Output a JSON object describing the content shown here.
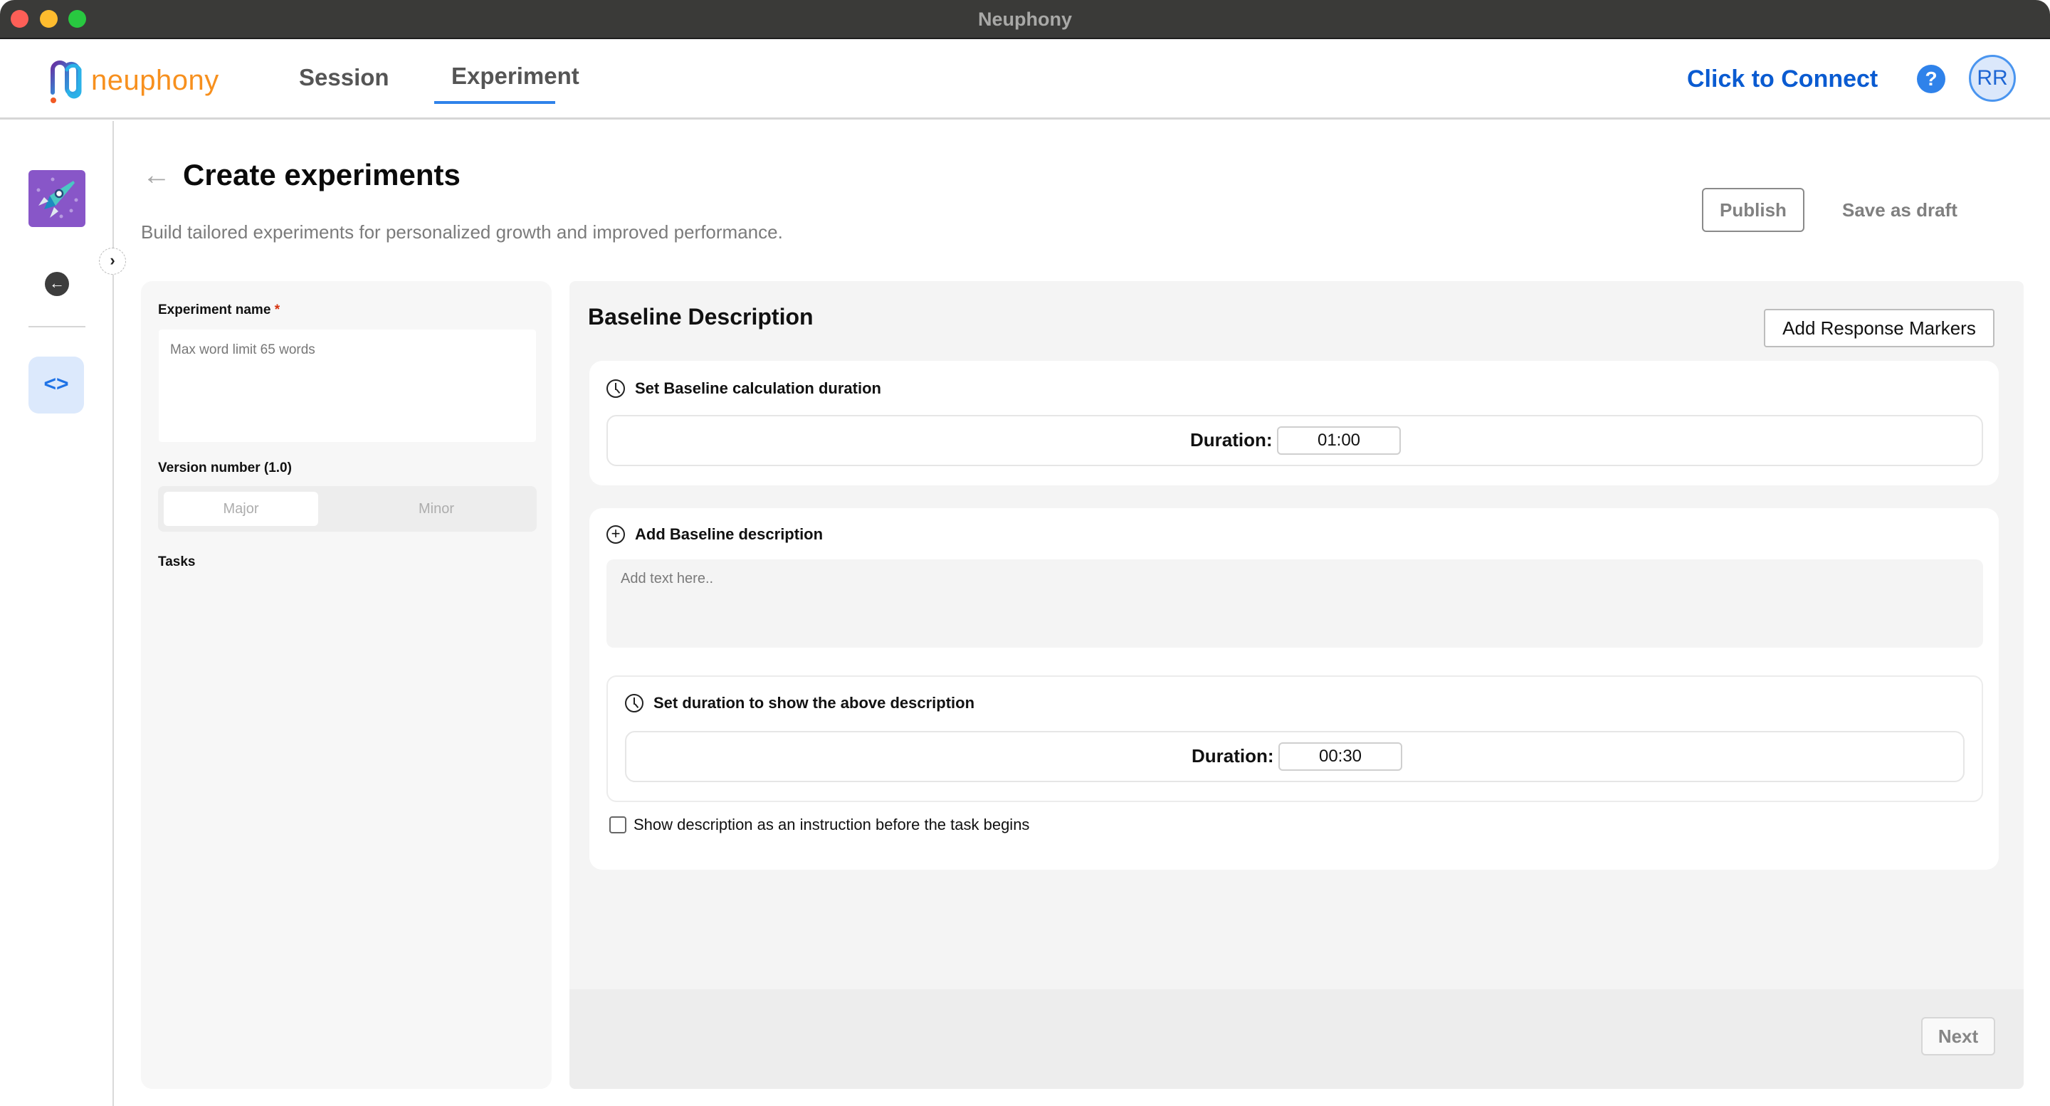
{
  "window": {
    "title": "Neuphony"
  },
  "header": {
    "logo_text": "neuphony",
    "tabs": [
      {
        "label": "Session",
        "active": false
      },
      {
        "label": "Experiment",
        "active": true
      }
    ],
    "connect_label": "Click to Connect",
    "help_icon": "help-circle-icon",
    "avatar_initials": "RR"
  },
  "sidebar": {
    "items": [
      {
        "icon": "rocket-icon",
        "label": ""
      },
      {
        "icon": "arrow-left-circle-icon",
        "label": ""
      },
      {
        "icon": "code-brackets-icon",
        "label": "",
        "active": true
      }
    ],
    "toggle_glyph": "›"
  },
  "page": {
    "back_glyph": "←",
    "title": "Create experiments",
    "subtitle": "Build tailored experiments for personalized growth and improved performance.",
    "publish_label": "Publish",
    "save_draft_label": "Save as draft"
  },
  "left_panel": {
    "experiment_name_label": "Experiment name",
    "required_mark": "*",
    "experiment_name_value": "",
    "experiment_name_placeholder": "Max word limit 65 words",
    "version_label": "Version number (1.0)",
    "version_options": [
      "Major",
      "Minor"
    ],
    "version_selected": "Major",
    "tasks_label": "Tasks"
  },
  "right_panel": {
    "title": "Baseline Description",
    "add_markers_label": "Add Response Markers",
    "baseline_duration": {
      "heading": "Set Baseline calculation duration",
      "duration_label": "Duration:",
      "duration_value": "01:00"
    },
    "baseline_description": {
      "heading": "Add Baseline description",
      "placeholder": "Add text here..",
      "value": "",
      "show_duration": {
        "heading": "Set duration to show the above description",
        "duration_label": "Duration:",
        "duration_value": "00:30"
      },
      "instruction_checkbox_label": "Show description as an instruction before the task begins",
      "instruction_checked": false
    },
    "next_label": "Next"
  }
}
